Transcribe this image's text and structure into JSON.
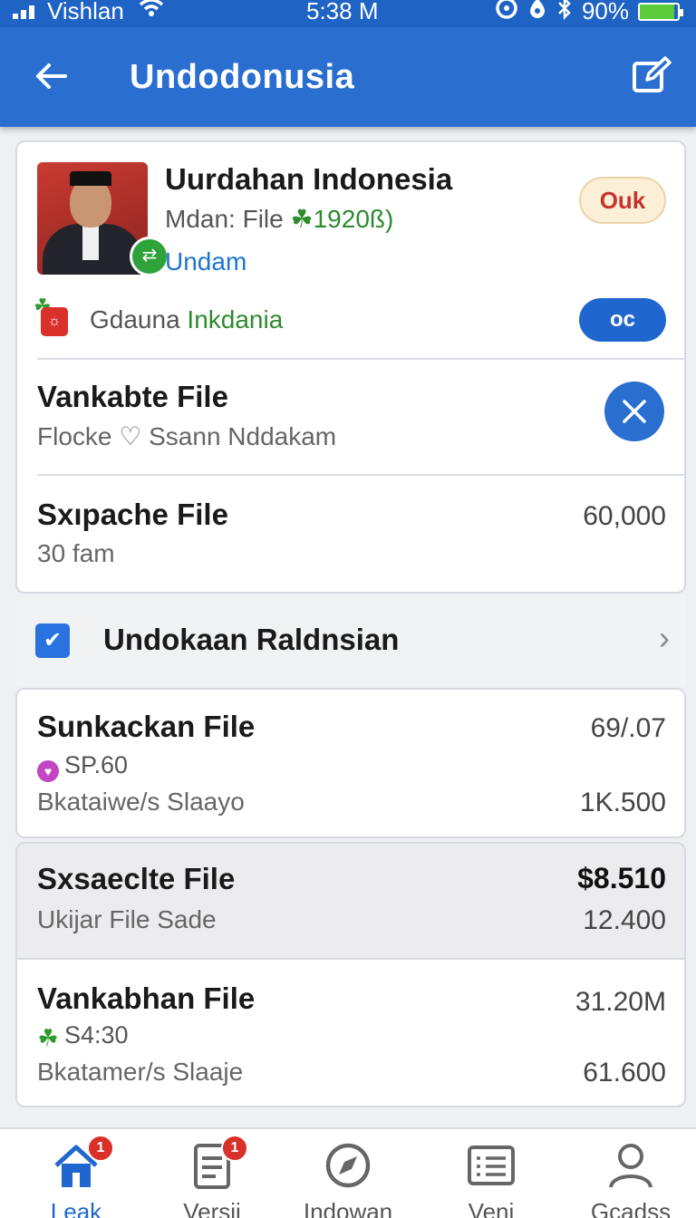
{
  "status_bar": {
    "carrier": "Vishlan",
    "time": "5:38 M",
    "battery": "90%",
    "battery_level": 0.9
  },
  "app_bar": {
    "title": "Undodonusia"
  },
  "profile": {
    "name": "Uurdahan Indonesia",
    "subtitle_prefix": "Mdan: File",
    "subtitle_highlight": "1920ß)",
    "link": "Undam",
    "badge": "Ouk",
    "sub_row_text": "Gdauna",
    "sub_row_highlight": "Inkdania",
    "action_pill": "oc"
  },
  "rows": [
    {
      "title": "Vankabte File",
      "subtitle": "Flocke ♡ Ssann Nddakam"
    },
    {
      "title": "Sxıpache File",
      "subtitle": "30 fam",
      "value": "60,000"
    }
  ],
  "section": {
    "label": "Undokaan Raldnsian"
  },
  "items": [
    {
      "title": "Sunkackan File",
      "tag": "SP.60",
      "subtitle": "Bkataiwe/s Slaayo",
      "value_top": "69/.07",
      "value_bottom": "1K.500"
    },
    {
      "title": "Sxsaeclte File",
      "subtitle": "Ukijar File Sade",
      "value_top": "$8.510",
      "value_bottom": "12.400"
    },
    {
      "title": "Vankabhan File",
      "tag": "S4:30",
      "subtitle": "Bkatamer/s Slaaje",
      "value_top": "31.20M",
      "value_bottom": "61.600"
    }
  ],
  "bottom_nav": [
    {
      "label": "Leak",
      "icon": "home-icon",
      "badge": "1"
    },
    {
      "label": "Versii",
      "icon": "document-icon",
      "badge": "1"
    },
    {
      "label": "Indowan",
      "icon": "compass-icon"
    },
    {
      "label": "Veni",
      "icon": "list-icon"
    },
    {
      "label": "Gcadss",
      "icon": "user-icon"
    }
  ],
  "colors": {
    "primary": "#2a6fd0",
    "accent_green": "#2e8b2e",
    "badge_red": "#d9302a"
  }
}
